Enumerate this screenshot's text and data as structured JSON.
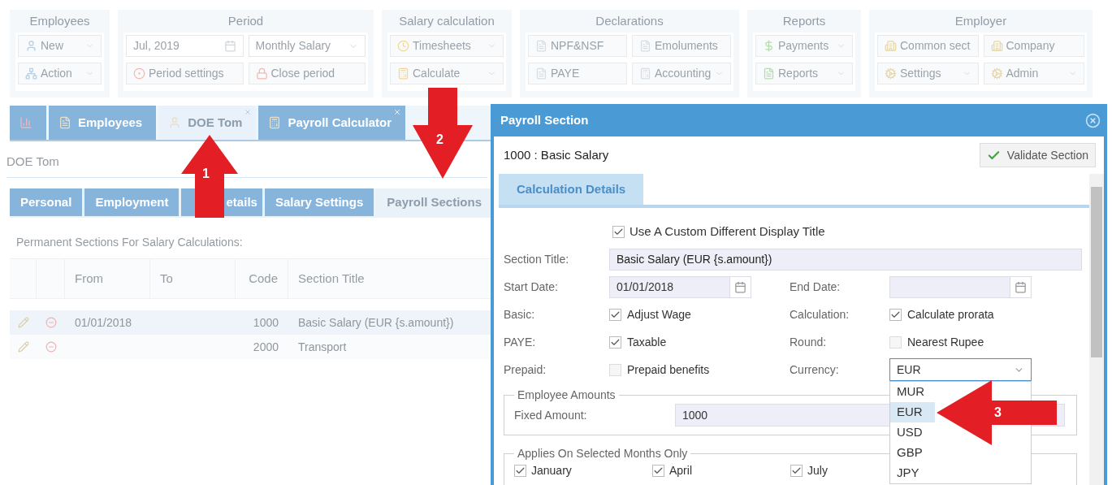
{
  "ribbon": {
    "groups": [
      {
        "title": "Employees",
        "rows": [
          [
            {
              "label": "New",
              "kind": "button",
              "dropdown": true
            }
          ],
          [
            {
              "label": "Action",
              "kind": "button",
              "dropdown": true
            }
          ]
        ]
      },
      {
        "title": "Period",
        "rows": [
          [
            {
              "label": "Jul, 2019",
              "kind": "date",
              "dropdown": false
            },
            {
              "label": "Monthly Salary",
              "kind": "select",
              "dropdown": true
            }
          ],
          [
            {
              "label": "Period settings",
              "kind": "button",
              "dropdown": false
            },
            {
              "label": "Close period",
              "kind": "button",
              "dropdown": false
            }
          ]
        ]
      },
      {
        "title": "Salary calculation",
        "rows": [
          [
            {
              "label": "Timesheets",
              "kind": "button",
              "dropdown": true
            }
          ],
          [
            {
              "label": "Calculate",
              "kind": "button",
              "dropdown": true
            }
          ]
        ]
      },
      {
        "title": "Declarations",
        "rows": [
          [
            {
              "label": "NPF&NSF",
              "kind": "button",
              "dropdown": false
            },
            {
              "label": "Emoluments",
              "kind": "button",
              "dropdown": false
            }
          ],
          [
            {
              "label": "PAYE",
              "kind": "button",
              "dropdown": false
            },
            {
              "label": "Accounting",
              "kind": "button",
              "dropdown": true
            }
          ]
        ]
      },
      {
        "title": "Reports",
        "rows": [
          [
            {
              "label": "Payments",
              "kind": "button",
              "dropdown": true
            }
          ],
          [
            {
              "label": "Reports",
              "kind": "button",
              "dropdown": true
            }
          ]
        ]
      },
      {
        "title": "Employer",
        "rows": [
          [
            {
              "label": "Common sect",
              "kind": "button",
              "dropdown": false
            },
            {
              "label": "Company",
              "kind": "button",
              "dropdown": false
            }
          ],
          [
            {
              "label": "Settings",
              "kind": "button",
              "dropdown": true
            },
            {
              "label": "Admin",
              "kind": "button",
              "dropdown": true
            }
          ]
        ]
      }
    ]
  },
  "tabs": [
    {
      "kind": "chart",
      "selected": false,
      "closable": false
    },
    {
      "label": "Employees",
      "kind": "list",
      "selected": false,
      "closable": false
    },
    {
      "label": "DOE Tom",
      "kind": "person",
      "selected": true,
      "closable": true
    },
    {
      "label": "Payroll Calculator",
      "kind": "calculator",
      "selected": false,
      "closable": true
    }
  ],
  "employee_name": "DOE Tom",
  "sub_tabs": [
    {
      "label": "Personal",
      "selected": false
    },
    {
      "label": "Employment",
      "selected": false
    },
    {
      "label": "etails",
      "selected": false
    },
    {
      "label": "Salary Settings",
      "selected": false
    },
    {
      "label": "Payroll Sections",
      "selected": true
    }
  ],
  "sections_caption": "Permanent Sections For Salary Calculations:",
  "table": {
    "columns": [
      "From",
      "To",
      "Code",
      "Section Title"
    ],
    "rows": [
      {
        "from": "01/01/2018",
        "to": "",
        "code": "1000",
        "title": "Basic Salary (EUR {s.amount})",
        "selected": true
      },
      {
        "from": "",
        "to": "",
        "code": "2000",
        "title": "Transport",
        "selected": false
      }
    ]
  },
  "dialog": {
    "title": "Payroll Section",
    "heading": "1000 : Basic Salary",
    "validate_button": "Validate Section",
    "tabs": [
      {
        "label": "Calculation Details",
        "selected": true
      }
    ],
    "custom_title": {
      "label": "Use A Custom Different Display Title",
      "checked": true
    },
    "section_title": {
      "label": "Section Title:",
      "value": "Basic Salary (EUR {s.amount})"
    },
    "dates": [
      {
        "label": "Start Date:",
        "value": "01/01/2018"
      },
      {
        "label": "End Date:"
      }
    ],
    "options": [
      [
        {
          "label": "Basic:",
          "kind": "checkbox",
          "text": "Adjust Wage",
          "checked": true
        },
        {
          "label": "Calculation:",
          "kind": "checkbox",
          "text": "Calculate prorata",
          "checked": true
        }
      ],
      [
        {
          "label": "PAYE:",
          "kind": "checkbox",
          "text": "Taxable",
          "checked": true
        },
        {
          "label": "Round:",
          "kind": "checkbox",
          "text": "Nearest Rupee",
          "checked": false
        }
      ],
      [
        {
          "label": "Prepaid:",
          "kind": "checkbox",
          "text": "Prepaid benefits",
          "checked": false
        },
        {
          "label": "Currency:",
          "kind": "select",
          "value": "EUR",
          "expanded": true,
          "options": [
            {
              "label": "MUR",
              "selected": false
            },
            {
              "label": "EUR",
              "selected": true
            },
            {
              "label": "USD",
              "selected": false
            },
            {
              "label": "GBP",
              "selected": false
            },
            {
              "label": "JPY",
              "selected": false
            }
          ]
        }
      ]
    ],
    "employee_amounts": {
      "legend": "Employee Amounts",
      "label": "Fixed Amount:",
      "value": "1000"
    },
    "months": {
      "legend": "Applies On Selected Months Only",
      "items": [
        {
          "label": "January",
          "checked": true
        },
        {
          "label": "April",
          "checked": true
        },
        {
          "label": "July",
          "checked": true
        }
      ]
    }
  },
  "annotations": [
    {
      "number": "1",
      "kind": "up"
    },
    {
      "number": "2",
      "kind": "down"
    },
    {
      "number": "3",
      "kind": "left"
    }
  ]
}
